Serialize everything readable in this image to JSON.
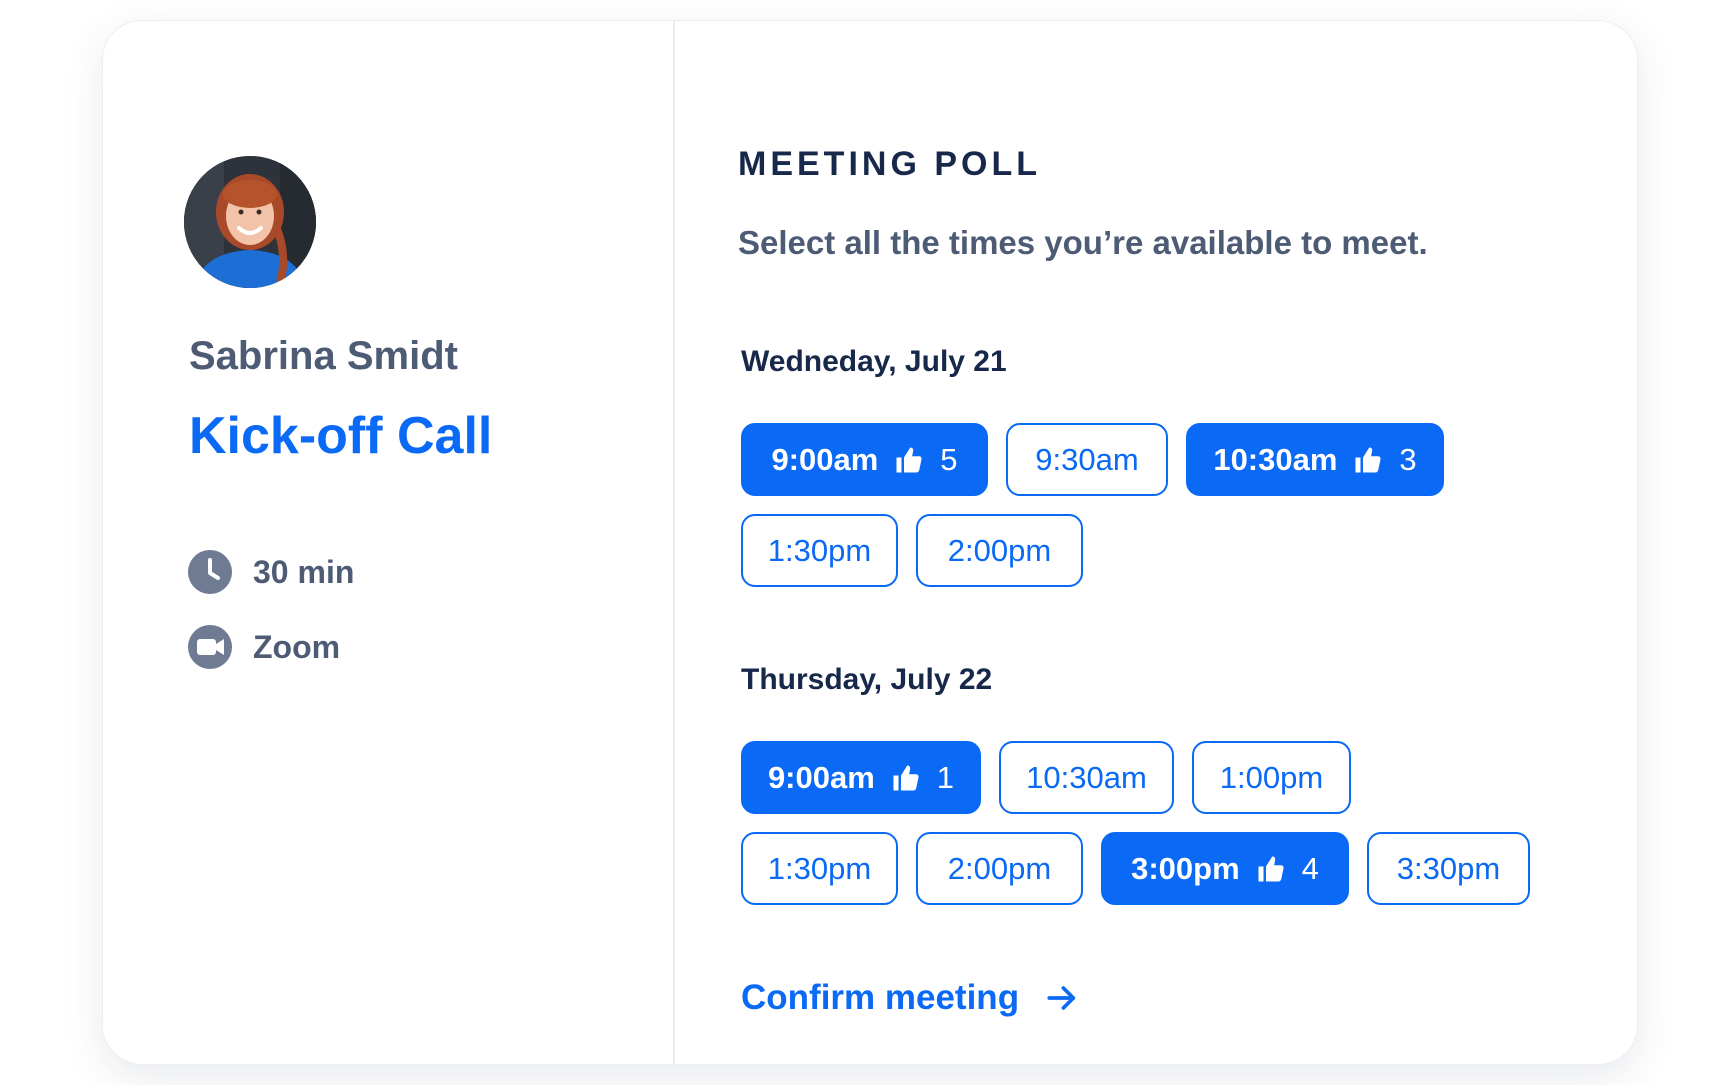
{
  "host": {
    "name": "Sabrina Smidt"
  },
  "event": {
    "title": "Kick-off Call",
    "duration": "30 min",
    "location": "Zoom"
  },
  "poll": {
    "heading": "MEETING POLL",
    "instructions": "Select all the times you’re available to meet.",
    "days": [
      {
        "label": "Wedneday, July 21",
        "slots": [
          {
            "time": "9:00am",
            "selected": true,
            "votes": "5"
          },
          {
            "time": "9:30am",
            "selected": false
          },
          {
            "time": "10:30am",
            "selected": true,
            "votes": "3"
          },
          {
            "time": "1:30pm",
            "selected": false
          },
          {
            "time": "2:00pm",
            "selected": false
          }
        ]
      },
      {
        "label": "Thursday, July 22",
        "slots": [
          {
            "time": "9:00am",
            "selected": true,
            "votes": "1"
          },
          {
            "time": "10:30am",
            "selected": false
          },
          {
            "time": "1:00pm",
            "selected": false
          },
          {
            "time": "1:30pm",
            "selected": false
          },
          {
            "time": "2:00pm",
            "selected": false
          },
          {
            "time": "3:00pm",
            "selected": true,
            "votes": "4"
          },
          {
            "time": "3:30pm",
            "selected": false
          }
        ]
      }
    ]
  },
  "actions": {
    "confirm_label": "Confirm meeting"
  },
  "icons": {
    "duration": "clock-icon",
    "location": "video-camera-icon",
    "votes": "thumbs-up-icon",
    "confirm": "arrow-right-icon"
  },
  "colors": {
    "accent": "#0a69f5",
    "heading": "#17284a",
    "muted_text": "#4d5b74",
    "icon_gray": "#6e7b92"
  }
}
